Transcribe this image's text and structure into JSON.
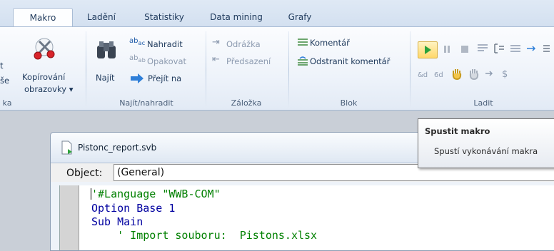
{
  "tabs": [
    {
      "label": "Makro"
    },
    {
      "label": "Ladění"
    },
    {
      "label": "Statistiky"
    },
    {
      "label": "Data mining"
    },
    {
      "label": "Grafy"
    }
  ],
  "ribbon": {
    "clipped_left": {
      "top": "t",
      "mid": "še",
      "bottom": "ka"
    },
    "copy_screen": {
      "line1": "Kopírování",
      "line2": "obrazovky ▾"
    },
    "find": {
      "najit": "Najít",
      "nahradit": "Nahradit",
      "opakovat": "Opakovat",
      "prejit": "Přejít na",
      "group": "Najít/nahradit"
    },
    "bookmark": {
      "odrazka": "Odrážka",
      "predsazeni": "Předsazení",
      "group": "Záložka"
    },
    "block": {
      "komentar": "Komentář",
      "odstranit": "Odstranit komentář",
      "group": "Blok"
    },
    "debug": {
      "group": "Ladit"
    }
  },
  "tooltip": {
    "title": "Spustit makro",
    "description": "Spustí vykonávání makra"
  },
  "editor": {
    "file_title": "Pistonc_report.svb",
    "object_label": "Object:",
    "object_value": "(General)",
    "lines": [
      "'#Language \"WWB-COM\"",
      "Option Base 1",
      "Sub Main",
      "    ' Import souboru:  Pistons.xlsx"
    ]
  },
  "colors": {
    "keyword": "#0000a0",
    "comment": "#008000",
    "tab_text": "#1e395b"
  }
}
